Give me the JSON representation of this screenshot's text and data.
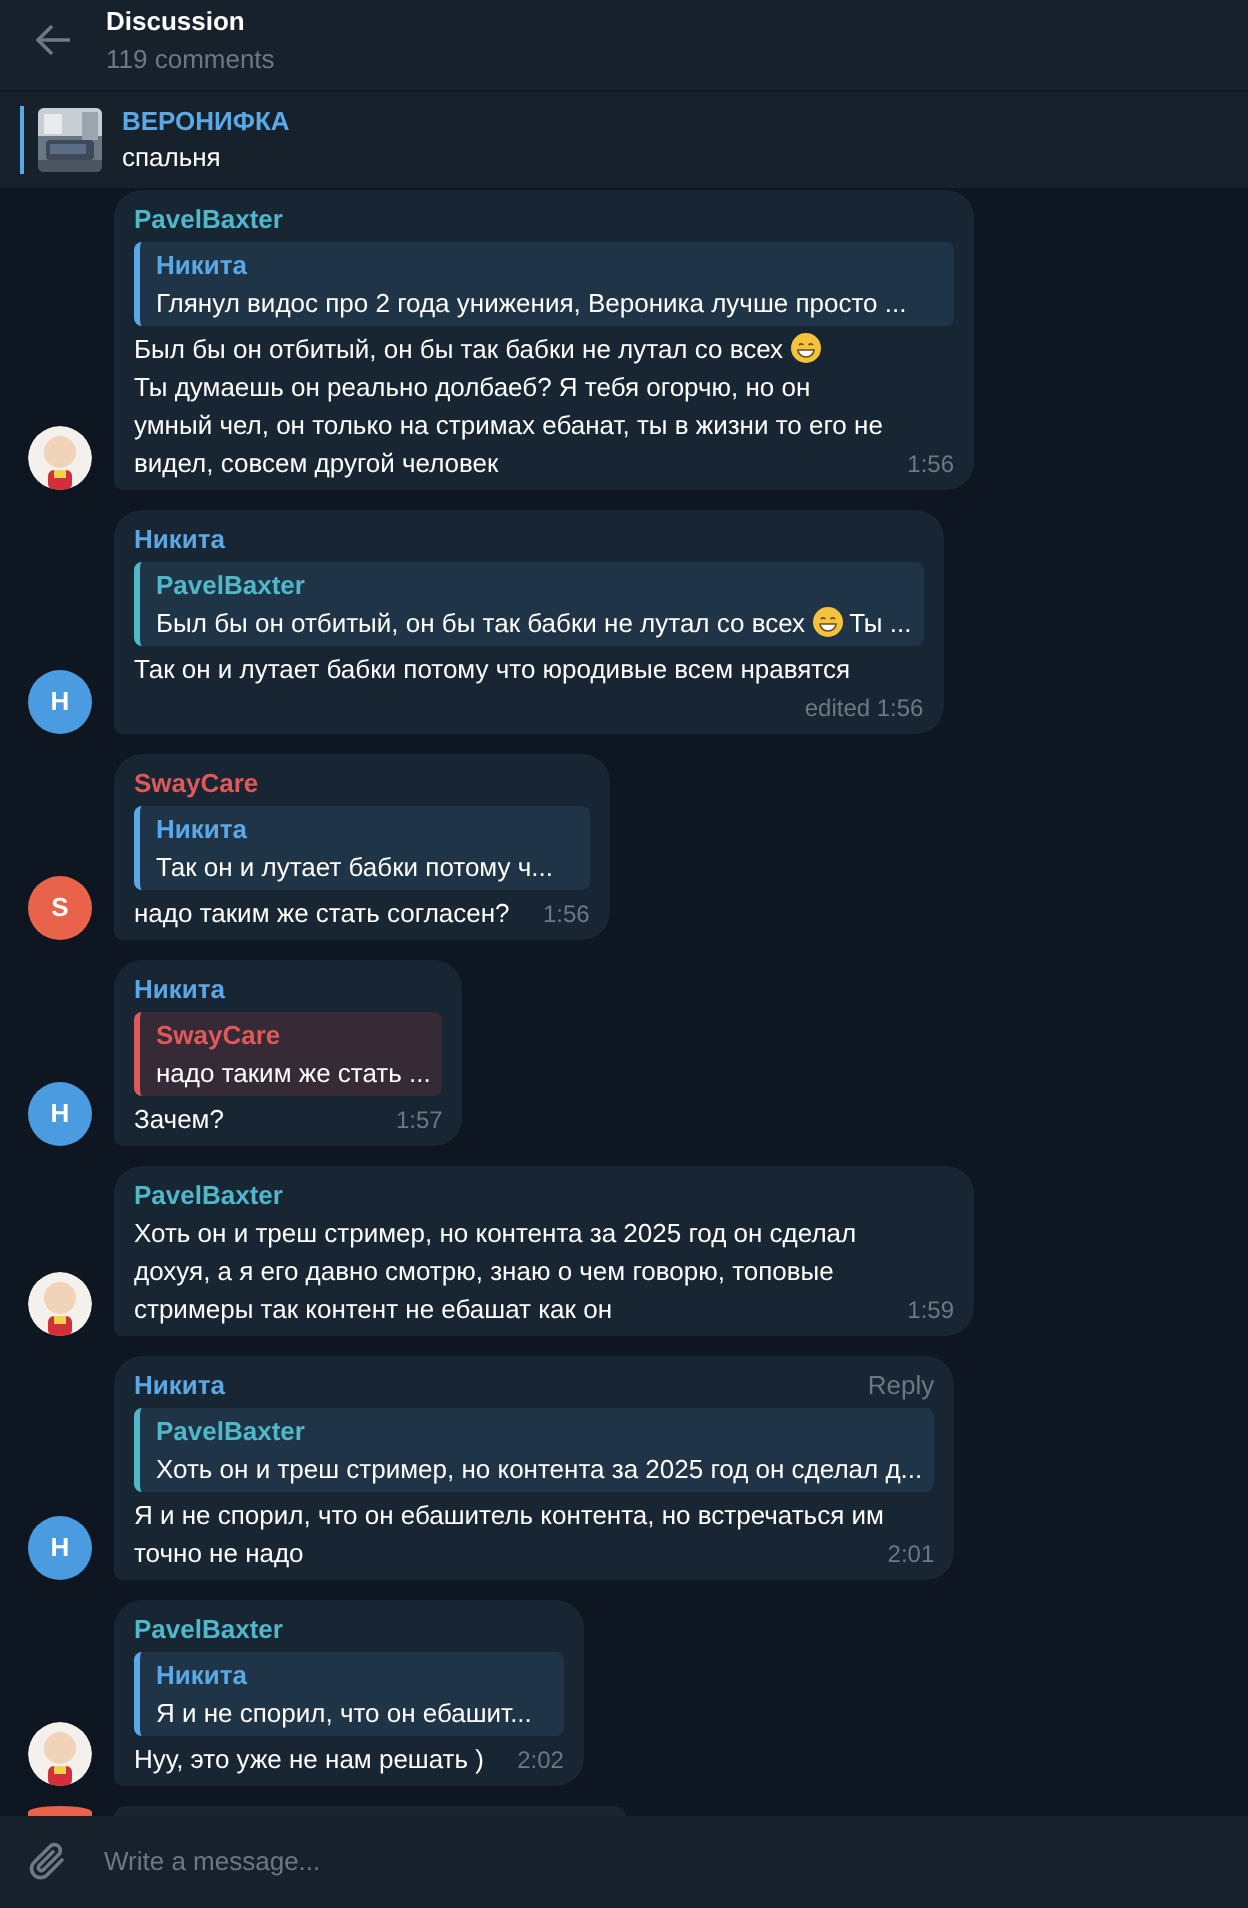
{
  "header": {
    "title": "Discussion",
    "subtitle": "119 comments"
  },
  "pinned": {
    "title": "ВЕРОНИФКА",
    "text": "спальня"
  },
  "messages": [
    {
      "kind": "message",
      "author": "PavelBaxter",
      "color": "#4fb8c9",
      "quote": {
        "author": "Никита",
        "color": "#5aa9e6",
        "parts": [
          {
            "kind": "text",
            "text": "Глянул видос про 2 года унижения, Вероника лучше просто ..."
          }
        ]
      },
      "body": [
        {
          "kind": "text",
          "text": "Был бы он отбитый, он бы так бабки не лутал со всех"
        },
        {
          "kind": "emoji"
        },
        {
          "kind": "break"
        },
        {
          "kind": "text",
          "text": "Ты думаешь он реально долбаеб? Я тебя огорчю, но он умный чел, он только на стримах ебанат, ты в жизни то его не видел, совсем другой человек"
        }
      ],
      "time": "1:56"
    },
    {
      "kind": "message",
      "author": "Никита",
      "color": "#5aa9e6",
      "avatar": {
        "kind": "letter",
        "letter": "Н",
        "color": "#4a9be0"
      },
      "quote": {
        "author": "PavelBaxter",
        "color": "#4fb8c9",
        "parts": [
          {
            "kind": "text",
            "text": "Был бы он отбитый, он бы так бабки не лутал со всех"
          },
          {
            "kind": "emoji"
          },
          {
            "kind": "text",
            "text": "Ты ..."
          }
        ]
      },
      "body": [
        {
          "kind": "text",
          "text": "Так он и лутает бабки потому что юродивые всем нравятся"
        }
      ],
      "time": "edited 1:56"
    },
    {
      "kind": "message",
      "author": "SwayCare",
      "color": "#e0595a",
      "avatar": {
        "kind": "letter",
        "letter": "S",
        "color": "#e8634a"
      },
      "quote": {
        "author": "Никита",
        "color": "#5aa9e6",
        "parts": [
          {
            "kind": "text",
            "text": "Так он и лутает бабки потому ч..."
          }
        ]
      },
      "body": [
        {
          "kind": "text",
          "text": "надо таким же стать согласен?"
        }
      ],
      "time": "1:56"
    },
    {
      "kind": "message",
      "author": "Никита",
      "color": "#5aa9e6",
      "avatar": {
        "kind": "letter",
        "letter": "Н",
        "color": "#4a9be0"
      },
      "quote": {
        "author": "SwayCare",
        "color": "#e0595a",
        "parts": [
          {
            "kind": "text",
            "text": "надо таким же стать ..."
          }
        ]
      },
      "body": [
        {
          "kind": "text",
          "text": "Зачем?"
        }
      ],
      "time": "1:57"
    },
    {
      "kind": "message",
      "author": "PavelBaxter",
      "color": "#4fb8c9",
      "body": [
        {
          "kind": "text",
          "text": "Хоть он и треш стример, но контента за 2025 год он сделал дохуя, а я его давно смотрю, знаю о чем говорю, топовые стримеры так контент не ебашат как он"
        }
      ],
      "time": "1:59"
    },
    {
      "kind": "message",
      "author": "Никита",
      "color": "#5aa9e6",
      "reply_action": "Reply",
      "avatar": {
        "kind": "letter",
        "letter": "Н",
        "color": "#4a9be0"
      },
      "quote": {
        "author": "PavelBaxter",
        "color": "#4fb8c9",
        "parts": [
          {
            "kind": "text",
            "text": "Хоть он и треш стример, но контента за 2025 год он сделал д..."
          }
        ]
      },
      "body": [
        {
          "kind": "text",
          "text": "Я и не спорил, что он ебашитель контента, но встречаться им точно не надо"
        }
      ],
      "time": "2:01"
    },
    {
      "kind": "message",
      "author": "PavelBaxter",
      "color": "#4fb8c9",
      "quote": {
        "author": "Никита",
        "color": "#5aa9e6",
        "parts": [
          {
            "kind": "text",
            "text": "Я и не спорил, что он ебашит..."
          }
        ]
      },
      "body": [
        {
          "kind": "text",
          "text": "Нуу, это уже не нам решать )"
        }
      ],
      "time": "2:02"
    },
    {
      "kind": "cut",
      "avatar": {
        "kind": "blank",
        "color": "#e8634a"
      }
    }
  ],
  "composer": {
    "placeholder": "Write a message..."
  }
}
